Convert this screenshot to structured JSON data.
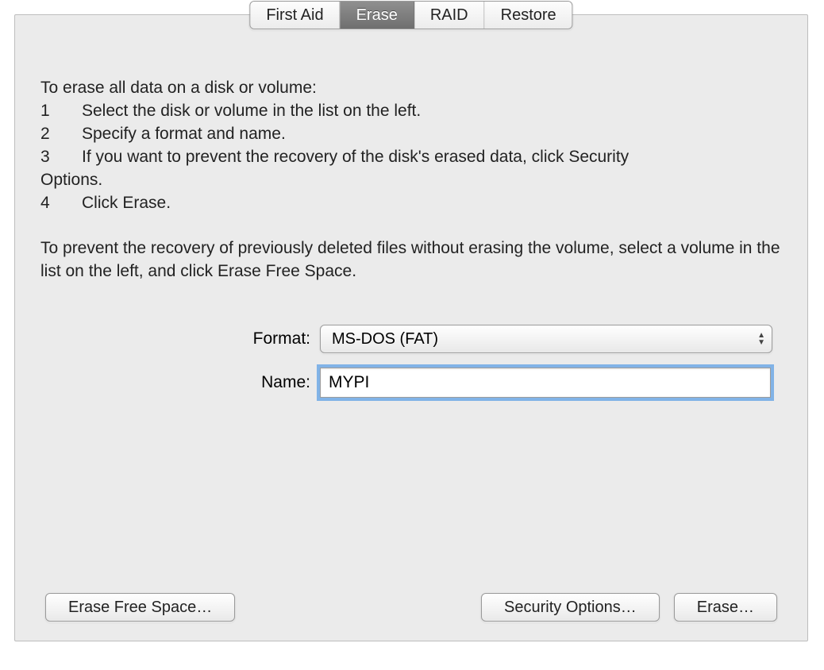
{
  "tabs": {
    "first_aid": "First Aid",
    "erase": "Erase",
    "raid": "RAID",
    "restore": "Restore"
  },
  "instructions": {
    "heading": "To erase all data on a disk or volume:",
    "step1_num": "1",
    "step1_text": "Select the disk or volume in the list on the left.",
    "step2_num": "2",
    "step2_text": "Specify a format and name.",
    "step3_num": "3",
    "step3_text_a": "If you want to prevent the recovery of the disk's erased data, click Security",
    "step3_text_b": "Options.",
    "step4_num": "4",
    "step4_text": "Click Erase.",
    "paragraph2": "To prevent the recovery of previously deleted files without erasing the volume, select a volume in the list on the left, and click Erase Free Space."
  },
  "form": {
    "format_label": "Format:",
    "format_value": "MS-DOS (FAT)",
    "name_label": "Name:",
    "name_value": "MYPI"
  },
  "buttons": {
    "erase_free_space": "Erase Free Space…",
    "security_options": "Security Options…",
    "erase": "Erase…"
  }
}
